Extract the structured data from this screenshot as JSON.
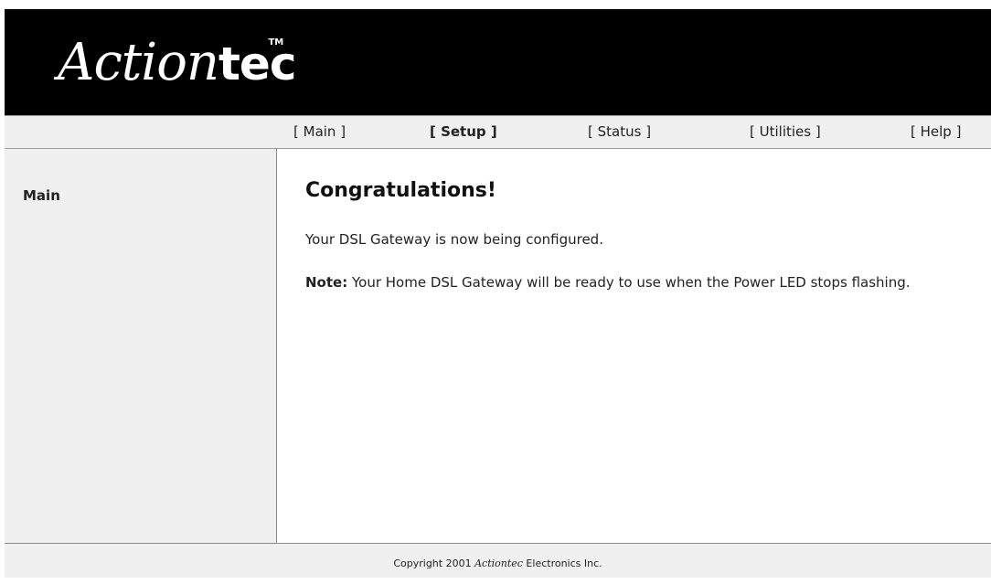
{
  "header": {
    "logo_script": "Action",
    "logo_bold": "tec",
    "logo_tm": "TM"
  },
  "nav": {
    "items": [
      {
        "open": "[ ",
        "label": "Main",
        "close": " ]",
        "active": false
      },
      {
        "open": "[ ",
        "label": "Setup",
        "close": " ]",
        "active": true
      },
      {
        "open": "[ ",
        "label": "Status",
        "close": " ]",
        "active": false
      },
      {
        "open": "[ ",
        "label": "Utilities",
        "close": " ]",
        "active": false
      },
      {
        "open": "[ ",
        "label": "Help",
        "close": " ]",
        "active": false
      }
    ]
  },
  "sidebar": {
    "label": "Main"
  },
  "main": {
    "title": "Congratulations!",
    "message": "Your DSL Gateway is now being configured.",
    "note_label": "Note:",
    "note_text": " Your Home DSL Gateway will be ready to use when the Power LED stops flashing."
  },
  "footer": {
    "prefix": "Copyright 2001 ",
    "brand": "Actiontec",
    "suffix": " Electronics Inc."
  },
  "colors": {
    "header_bg": "#000000",
    "panel_bg": "#f0f0f0",
    "border": "#8a8a8a"
  }
}
